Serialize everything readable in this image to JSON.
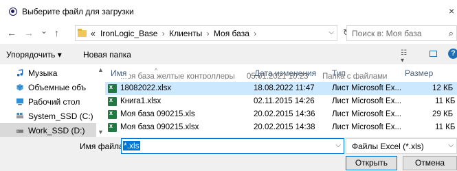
{
  "window": {
    "title": "Выберите файл для загрузки",
    "close": "×"
  },
  "nav": {
    "back": "←",
    "forward": "→",
    "recent": "⌄",
    "up": "↑",
    "breadcrumbs": [
      "«",
      "IronLogic_Base",
      "›",
      "Клиенты",
      "›",
      "Моя база",
      "›"
    ],
    "search_placeholder": "Поиск в: Моя база"
  },
  "toolbar": {
    "organize": "Упорядочить ▾",
    "new_folder": "Новая папка"
  },
  "navpane": {
    "items": [
      {
        "label": "Музыка",
        "icon": "music-icon"
      },
      {
        "label": "Объемные объ",
        "icon": "3d-objects-icon"
      },
      {
        "label": "Рабочий стол",
        "icon": "desktop-icon"
      },
      {
        "label": "System_SSD (C:)",
        "icon": "drive-icon"
      },
      {
        "label": "Work_SSD (D:)",
        "icon": "drive-icon",
        "selected": true
      }
    ]
  },
  "filelist": {
    "columns": [
      "Имя",
      "Дата изменения",
      "Тип",
      "Размер"
    ],
    "partial_row": {
      "name": "Моя база желтые контроллеры",
      "date": "05.01.2021 10:23",
      "type": "Папка с файлами"
    },
    "rows": [
      {
        "name": "18082022.xlsx",
        "date": "18.08.2022 11:47",
        "type": "Лист Microsoft Ex...",
        "size": "12 КБ",
        "selected": true
      },
      {
        "name": "Книга1.xlsx",
        "date": "02.11.2015 14:26",
        "type": "Лист Microsoft Ex...",
        "size": "11 КБ"
      },
      {
        "name": "Моя база 090215.xls",
        "date": "20.02.2015 14:36",
        "type": "Лист Microsoft Ex...",
        "size": "29 КБ"
      },
      {
        "name": "Моя база 090215.xlsx",
        "date": "20.02.2015 14:38",
        "type": "Лист Microsoft Ex...",
        "size": "11 КБ"
      }
    ]
  },
  "bottom": {
    "filename_label": "Имя файла:",
    "filename_value": "*.xls",
    "filetype_value": "Файлы Excel (*.xls)",
    "open_label": "Открыть",
    "cancel_label": "Отмена"
  },
  "colors": {
    "accent": "#0078d7",
    "selection": "#cce8ff",
    "excel": "#1f7a43"
  }
}
